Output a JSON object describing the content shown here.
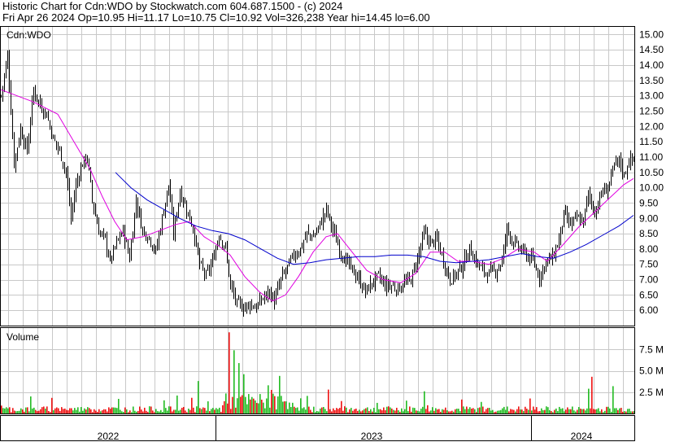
{
  "header": {
    "line1": "Historic Chart for Cdn:WDO by Stockwatch.com 604.687.1500 - (c) 2024",
    "line2": "Fri Apr 26 2024   Op=10.95   Hi=11.17   Lo=10.75   Cl=10.92   Vol=326,238   Year hi=14.45   lo=6.00"
  },
  "colors": {
    "price_bar": "#000000",
    "ma_short": "#e000e0",
    "ma_long": "#0000cc",
    "vol_up": "#22bb22",
    "vol_down": "#ee1111",
    "grid": "#c8c8c8"
  },
  "chart_data": [
    {
      "type": "ohlc",
      "panel_label": "Cdn:WDO",
      "ylim": [
        5.5,
        15.25
      ],
      "yticks": [
        "15.00",
        "14.50",
        "14.00",
        "13.50",
        "13.00",
        "12.50",
        "12.00",
        "11.50",
        "11.00",
        "10.50",
        "10.00",
        "9.50",
        "9.00",
        "8.50",
        "8.00",
        "7.50",
        "7.00",
        "6.50",
        "6.00"
      ],
      "x_labels": [
        "2022",
        "2023",
        "2024"
      ],
      "close_series": [
        {
          "t": 0,
          "v": 13.0
        },
        {
          "t": 8,
          "v": 14.3
        },
        {
          "t": 16,
          "v": 10.8
        },
        {
          "t": 24,
          "v": 11.9
        },
        {
          "t": 32,
          "v": 11.2
        },
        {
          "t": 40,
          "v": 13.2
        },
        {
          "t": 48,
          "v": 12.7
        },
        {
          "t": 56,
          "v": 12.4
        },
        {
          "t": 64,
          "v": 11.6
        },
        {
          "t": 72,
          "v": 11.2
        },
        {
          "t": 80,
          "v": 10.5
        },
        {
          "t": 86,
          "v": 9.0
        },
        {
          "t": 92,
          "v": 10.1
        },
        {
          "t": 100,
          "v": 10.8
        },
        {
          "t": 106,
          "v": 11.0
        },
        {
          "t": 112,
          "v": 9.6
        },
        {
          "t": 120,
          "v": 8.6
        },
        {
          "t": 128,
          "v": 8.3
        },
        {
          "t": 134,
          "v": 7.6
        },
        {
          "t": 142,
          "v": 8.2
        },
        {
          "t": 150,
          "v": 8.6
        },
        {
          "t": 158,
          "v": 7.7
        },
        {
          "t": 166,
          "v": 9.6
        },
        {
          "t": 174,
          "v": 8.6
        },
        {
          "t": 182,
          "v": 8.4
        },
        {
          "t": 190,
          "v": 7.9
        },
        {
          "t": 198,
          "v": 9.0
        },
        {
          "t": 206,
          "v": 10.1
        },
        {
          "t": 212,
          "v": 8.5
        },
        {
          "t": 220,
          "v": 9.9
        },
        {
          "t": 228,
          "v": 9.3
        },
        {
          "t": 236,
          "v": 8.7
        },
        {
          "t": 244,
          "v": 7.5
        },
        {
          "t": 252,
          "v": 7.1
        },
        {
          "t": 260,
          "v": 7.6
        },
        {
          "t": 268,
          "v": 8.5
        },
        {
          "t": 276,
          "v": 8.0
        },
        {
          "t": 282,
          "v": 6.8
        },
        {
          "t": 290,
          "v": 6.2
        },
        {
          "t": 298,
          "v": 6.1
        },
        {
          "t": 306,
          "v": 6.2
        },
        {
          "t": 314,
          "v": 6.1
        },
        {
          "t": 322,
          "v": 6.4
        },
        {
          "t": 330,
          "v": 6.6
        },
        {
          "t": 336,
          "v": 6.3
        },
        {
          "t": 344,
          "v": 7.0
        },
        {
          "t": 352,
          "v": 7.4
        },
        {
          "t": 360,
          "v": 7.8
        },
        {
          "t": 368,
          "v": 8.0
        },
        {
          "t": 376,
          "v": 8.5
        },
        {
          "t": 384,
          "v": 8.4
        },
        {
          "t": 392,
          "v": 8.8
        },
        {
          "t": 400,
          "v": 9.3
        },
        {
          "t": 408,
          "v": 8.6
        },
        {
          "t": 416,
          "v": 8.0
        },
        {
          "t": 424,
          "v": 7.6
        },
        {
          "t": 432,
          "v": 7.3
        },
        {
          "t": 440,
          "v": 7.0
        },
        {
          "t": 448,
          "v": 6.6
        },
        {
          "t": 456,
          "v": 6.9
        },
        {
          "t": 464,
          "v": 7.1
        },
        {
          "t": 472,
          "v": 6.8
        },
        {
          "t": 480,
          "v": 6.8
        },
        {
          "t": 488,
          "v": 6.7
        },
        {
          "t": 496,
          "v": 6.9
        },
        {
          "t": 504,
          "v": 7.0
        },
        {
          "t": 512,
          "v": 7.7
        },
        {
          "t": 520,
          "v": 8.5
        },
        {
          "t": 528,
          "v": 8.2
        },
        {
          "t": 536,
          "v": 8.3
        },
        {
          "t": 544,
          "v": 7.6
        },
        {
          "t": 552,
          "v": 7.0
        },
        {
          "t": 560,
          "v": 7.2
        },
        {
          "t": 568,
          "v": 7.5
        },
        {
          "t": 576,
          "v": 8.0
        },
        {
          "t": 584,
          "v": 7.6
        },
        {
          "t": 592,
          "v": 7.3
        },
        {
          "t": 600,
          "v": 7.2
        },
        {
          "t": 608,
          "v": 7.3
        },
        {
          "t": 616,
          "v": 7.6
        },
        {
          "t": 622,
          "v": 8.7
        },
        {
          "t": 630,
          "v": 8.2
        },
        {
          "t": 638,
          "v": 8.0
        },
        {
          "t": 646,
          "v": 7.8
        },
        {
          "t": 654,
          "v": 7.6
        },
        {
          "t": 662,
          "v": 7.1
        },
        {
          "t": 670,
          "v": 7.6
        },
        {
          "t": 678,
          "v": 7.7
        },
        {
          "t": 686,
          "v": 8.3
        },
        {
          "t": 692,
          "v": 9.1
        },
        {
          "t": 700,
          "v": 8.8
        },
        {
          "t": 708,
          "v": 9.0
        },
        {
          "t": 716,
          "v": 8.9
        },
        {
          "t": 722,
          "v": 9.8
        },
        {
          "t": 730,
          "v": 9.2
        },
        {
          "t": 738,
          "v": 9.8
        },
        {
          "t": 746,
          "v": 10.0
        },
        {
          "t": 754,
          "v": 10.7
        },
        {
          "t": 760,
          "v": 10.9
        },
        {
          "t": 766,
          "v": 10.4
        },
        {
          "t": 772,
          "v": 10.9
        },
        {
          "t": 778,
          "v": 10.92
        }
      ],
      "ma_short": [
        {
          "t": 0,
          "v": 13.2
        },
        {
          "t": 40,
          "v": 12.8
        },
        {
          "t": 70,
          "v": 12.4
        },
        {
          "t": 90,
          "v": 11.5
        },
        {
          "t": 110,
          "v": 10.6
        },
        {
          "t": 125,
          "v": 9.7
        },
        {
          "t": 140,
          "v": 8.9
        },
        {
          "t": 155,
          "v": 8.3
        },
        {
          "t": 175,
          "v": 8.4
        },
        {
          "t": 195,
          "v": 8.6
        },
        {
          "t": 215,
          "v": 8.8
        },
        {
          "t": 232,
          "v": 8.9
        },
        {
          "t": 250,
          "v": 8.4
        },
        {
          "t": 268,
          "v": 8.1
        },
        {
          "t": 282,
          "v": 7.8
        },
        {
          "t": 300,
          "v": 7.1
        },
        {
          "t": 318,
          "v": 6.6
        },
        {
          "t": 334,
          "v": 6.3
        },
        {
          "t": 350,
          "v": 6.5
        },
        {
          "t": 366,
          "v": 7.1
        },
        {
          "t": 384,
          "v": 7.9
        },
        {
          "t": 400,
          "v": 8.4
        },
        {
          "t": 414,
          "v": 8.5
        },
        {
          "t": 432,
          "v": 7.9
        },
        {
          "t": 450,
          "v": 7.3
        },
        {
          "t": 470,
          "v": 7.0
        },
        {
          "t": 492,
          "v": 6.9
        },
        {
          "t": 510,
          "v": 7.2
        },
        {
          "t": 528,
          "v": 7.9
        },
        {
          "t": 546,
          "v": 7.9
        },
        {
          "t": 562,
          "v": 7.6
        },
        {
          "t": 580,
          "v": 7.6
        },
        {
          "t": 600,
          "v": 7.5
        },
        {
          "t": 618,
          "v": 7.7
        },
        {
          "t": 636,
          "v": 8.0
        },
        {
          "t": 656,
          "v": 7.9
        },
        {
          "t": 672,
          "v": 7.6
        },
        {
          "t": 690,
          "v": 8.1
        },
        {
          "t": 710,
          "v": 8.7
        },
        {
          "t": 730,
          "v": 9.2
        },
        {
          "t": 750,
          "v": 9.7
        },
        {
          "t": 766,
          "v": 10.1
        },
        {
          "t": 778,
          "v": 10.3
        }
      ],
      "ma_long": [
        {
          "t": 141,
          "v": 10.5
        },
        {
          "t": 160,
          "v": 10.0
        },
        {
          "t": 180,
          "v": 9.6
        },
        {
          "t": 200,
          "v": 9.3
        },
        {
          "t": 220,
          "v": 9.0
        },
        {
          "t": 240,
          "v": 8.75
        },
        {
          "t": 260,
          "v": 8.6
        },
        {
          "t": 280,
          "v": 8.5
        },
        {
          "t": 300,
          "v": 8.3
        },
        {
          "t": 320,
          "v": 8.0
        },
        {
          "t": 340,
          "v": 7.7
        },
        {
          "t": 360,
          "v": 7.5
        },
        {
          "t": 380,
          "v": 7.55
        },
        {
          "t": 400,
          "v": 7.65
        },
        {
          "t": 420,
          "v": 7.7
        },
        {
          "t": 440,
          "v": 7.75
        },
        {
          "t": 460,
          "v": 7.75
        },
        {
          "t": 480,
          "v": 7.8
        },
        {
          "t": 500,
          "v": 7.8
        },
        {
          "t": 520,
          "v": 7.75
        },
        {
          "t": 540,
          "v": 7.6
        },
        {
          "t": 560,
          "v": 7.55
        },
        {
          "t": 580,
          "v": 7.6
        },
        {
          "t": 600,
          "v": 7.65
        },
        {
          "t": 620,
          "v": 7.75
        },
        {
          "t": 640,
          "v": 7.85
        },
        {
          "t": 660,
          "v": 7.75
        },
        {
          "t": 680,
          "v": 7.7
        },
        {
          "t": 700,
          "v": 7.9
        },
        {
          "t": 720,
          "v": 8.15
        },
        {
          "t": 740,
          "v": 8.45
        },
        {
          "t": 760,
          "v": 8.75
        },
        {
          "t": 778,
          "v": 9.1
        }
      ]
    },
    {
      "type": "bar",
      "panel_label": "Volume",
      "ylim": [
        0,
        10000000
      ],
      "yticks": [
        "7.5 M",
        "5.0 M",
        "2.5 M"
      ],
      "spikes": [
        {
          "t": 281,
          "v": 9500000,
          "up": false
        },
        {
          "t": 286,
          "v": 7400000,
          "up": true
        },
        {
          "t": 292,
          "v": 5900000,
          "up": true
        },
        {
          "t": 298,
          "v": 4600000,
          "up": true
        },
        {
          "t": 343,
          "v": 4400000,
          "up": true
        },
        {
          "t": 243,
          "v": 3800000,
          "up": true
        },
        {
          "t": 329,
          "v": 3300000,
          "up": true
        },
        {
          "t": 726,
          "v": 4300000,
          "up": false
        },
        {
          "t": 722,
          "v": 2900000,
          "up": true
        },
        {
          "t": 753,
          "v": 3200000,
          "up": true
        },
        {
          "t": 402,
          "v": 2800000,
          "up": false
        },
        {
          "t": 520,
          "v": 2600000,
          "up": true
        }
      ]
    }
  ]
}
